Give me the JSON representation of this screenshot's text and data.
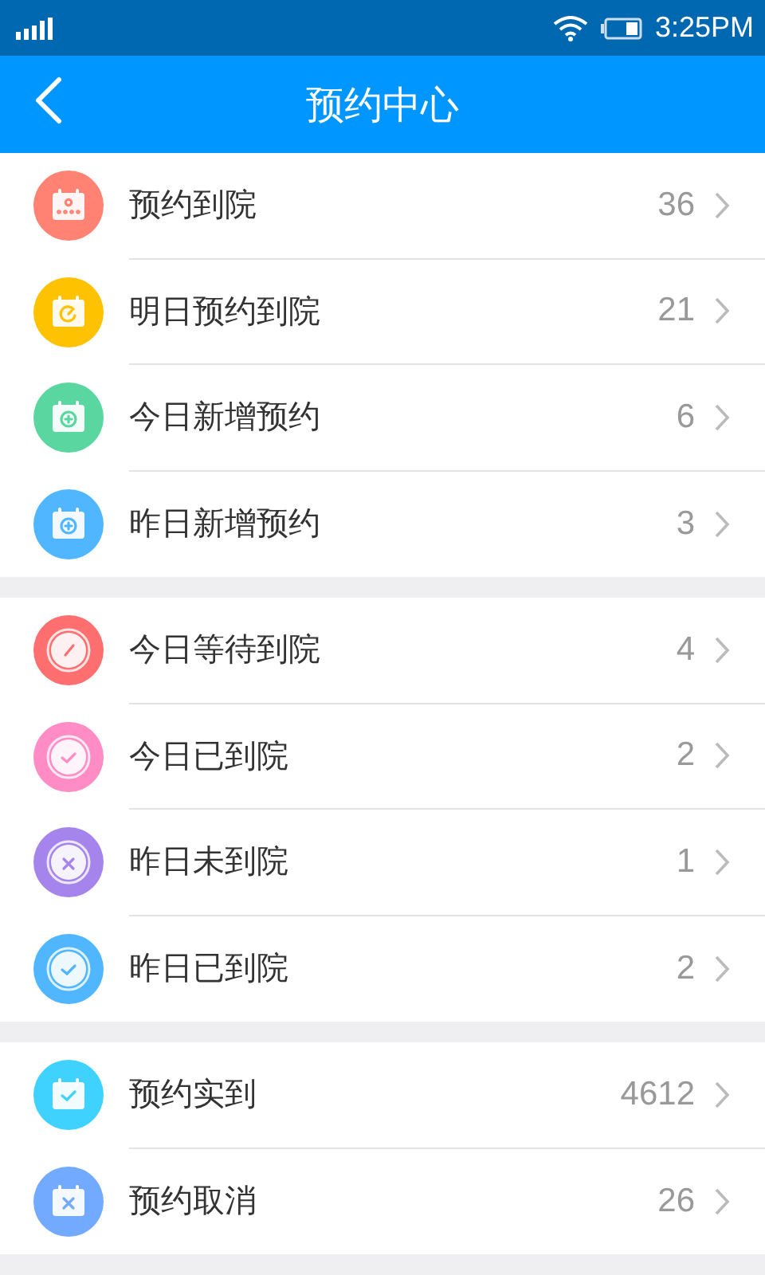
{
  "status_bar": {
    "time": "3:25PM"
  },
  "header": {
    "title": "预约中心"
  },
  "sections": [
    {
      "items": [
        {
          "kind": "calendar-dots",
          "color": "#ff8273",
          "label": "预约到院",
          "count": "36"
        },
        {
          "kind": "calendar-clock",
          "color": "#ffc200",
          "label": "明日预约到院",
          "count": "21"
        },
        {
          "kind": "calendar-plus",
          "color": "#5ad6a0",
          "label": "今日新增预约",
          "count": "6"
        },
        {
          "kind": "calendar-cycle-plus",
          "color": "#4fb6ff",
          "label": "昨日新增预约",
          "count": "3"
        }
      ]
    },
    {
      "items": [
        {
          "kind": "clock",
          "color": "#ff6f6f",
          "label": "今日等待到院",
          "count": "4"
        },
        {
          "kind": "circle-check",
          "color": "#ff8cc4",
          "label": "今日已到院",
          "count": "2"
        },
        {
          "kind": "cycle-cross",
          "color": "#a585eb",
          "label": "昨日未到院",
          "count": "1"
        },
        {
          "kind": "cycle-check",
          "color": "#4fb6ff",
          "label": "昨日已到院",
          "count": "2"
        }
      ]
    },
    {
      "items": [
        {
          "kind": "calendar-check",
          "color": "#40d2ff",
          "label": "预约实到",
          "count": "4612"
        },
        {
          "kind": "calendar-cross",
          "color": "#72aaff",
          "label": "预约取消",
          "count": "26"
        }
      ]
    }
  ]
}
